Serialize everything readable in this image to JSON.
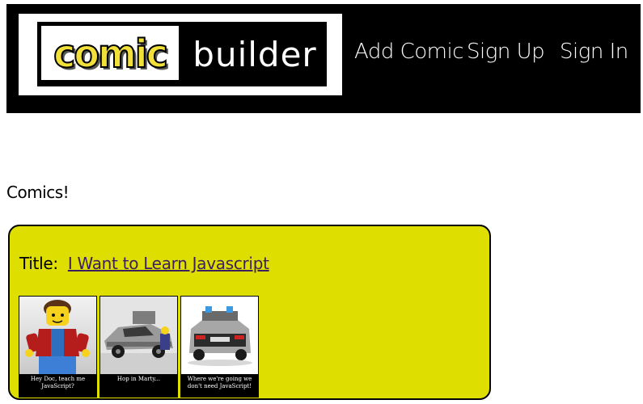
{
  "header": {
    "logo": {
      "word1": "comic",
      "word2": "builder"
    },
    "nav": [
      {
        "label": "Add Comic"
      },
      {
        "label": "Sign Up"
      },
      {
        "label": "Sign In"
      }
    ]
  },
  "main": {
    "heading": "Comics!",
    "comic": {
      "title_label": "Title:",
      "title": "I Want to Learn Javascript",
      "panels": [
        {
          "caption": "Hey Doc, teach me JavaScript?"
        },
        {
          "caption": "Hop in Marty..."
        },
        {
          "caption": "Where we're going we don't need JavaScript!"
        }
      ]
    }
  },
  "colors": {
    "header_bg": "#000000",
    "card_bg": "#dede00",
    "link": "#3b1f5e",
    "logo_comic": "#f1e03a"
  }
}
